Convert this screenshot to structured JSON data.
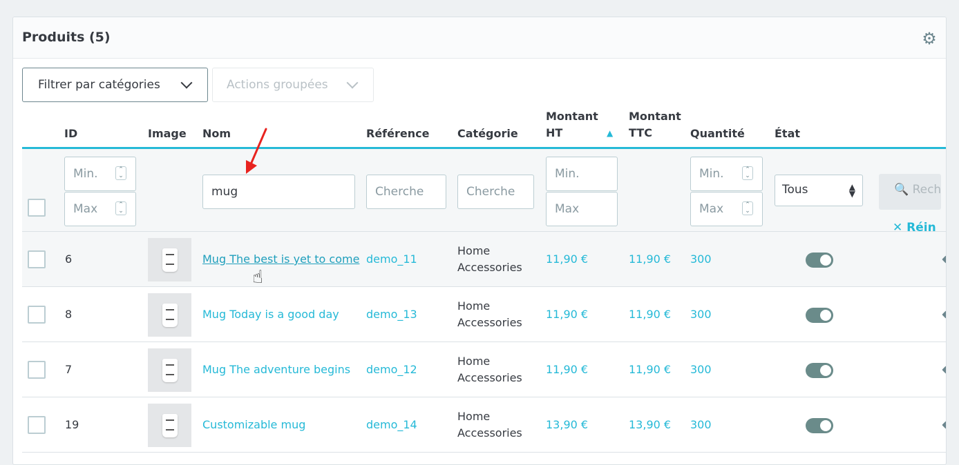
{
  "panel": {
    "title": "Produits (5)",
    "settings_icon": "gear-icon"
  },
  "toolbar": {
    "filter_categories_label": "Filtrer par catégories",
    "bulk_actions_label": "Actions groupées"
  },
  "table": {
    "headers": {
      "id": "ID",
      "image": "Image",
      "name": "Nom",
      "reference": "Référence",
      "category": "Catégorie",
      "price_ht_line1": "Montant",
      "price_ht_line2": "HT",
      "price_ttc_line1": "Montant",
      "price_ttc_line2": "TTC",
      "quantity": "Quantité",
      "status": "État"
    },
    "filters": {
      "id_min_placeholder": "Min.",
      "id_max_placeholder": "Max",
      "name_value": "mug",
      "reference_placeholder": "Cherche",
      "category_placeholder": "Cherche",
      "price_min_placeholder": "Min.",
      "price_max_placeholder": "Max",
      "qty_min_placeholder": "Min.",
      "qty_max_placeholder": "Max",
      "status_selected": "Tous",
      "search_label": "Rech",
      "reset_label": "Réin"
    },
    "rows": [
      {
        "id": "6",
        "name": "Mug The best is yet to come",
        "reference": "demo_11",
        "category_line1": "Home",
        "category_line2": "Accessories",
        "price_ht": "11,90 €",
        "price_ttc": "11,90 €",
        "quantity": "300",
        "active": true
      },
      {
        "id": "8",
        "name": "Mug Today is a good day",
        "reference": "demo_13",
        "category_line1": "Home",
        "category_line2": "Accessories",
        "price_ht": "11,90 €",
        "price_ttc": "11,90 €",
        "quantity": "300",
        "active": true
      },
      {
        "id": "7",
        "name": "Mug The adventure begins",
        "reference": "demo_12",
        "category_line1": "Home",
        "category_line2": "Accessories",
        "price_ht": "11,90 €",
        "price_ttc": "11,90 €",
        "quantity": "300",
        "active": true
      },
      {
        "id": "19",
        "name": "Customizable mug",
        "reference": "demo_14",
        "category_line1": "Home",
        "category_line2": "Accessories",
        "price_ht": "13,90 €",
        "price_ttc": "13,90 €",
        "quantity": "300",
        "active": true
      }
    ]
  },
  "colors": {
    "accent": "#25b9d7",
    "toggle_on": "#6a8b8a",
    "annotation_arrow": "#e8231f"
  }
}
